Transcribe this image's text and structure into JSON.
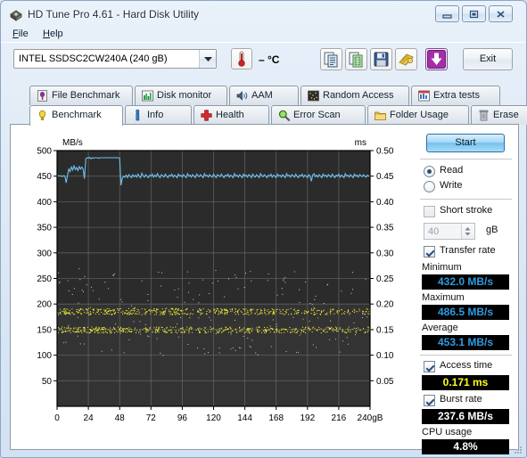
{
  "window": {
    "title": "HD Tune Pro 4.61 - Hard Disk Utility",
    "icon": "hdtune-app-icon",
    "minimize_label": "",
    "maximize_label": "",
    "close_label": ""
  },
  "menu": {
    "items": [
      {
        "label": "File",
        "mnemonic": "F"
      },
      {
        "label": "Help",
        "mnemonic": "H"
      }
    ]
  },
  "toolbar": {
    "drive": {
      "selected": "INTEL SSDSC2CW240A (240 gB)",
      "options": [
        "INTEL SSDSC2CW240A (240 gB)"
      ]
    },
    "temperature": {
      "icon": "thermometer-icon",
      "value": "– °C"
    },
    "buttons": [
      {
        "name": "copy-to-clipboard",
        "icon": "copy-icon"
      },
      {
        "name": "copy-to-spreadsheet",
        "icon": "excel-copy-icon"
      },
      {
        "name": "save-screenshot",
        "icon": "floppy-save-icon"
      },
      {
        "name": "certificate",
        "icon": "gold-folder-icon"
      },
      {
        "name": "download-update",
        "icon": "purple-down-arrow-icon"
      }
    ],
    "exit_label": "Exit"
  },
  "tabs": {
    "top_row": [
      {
        "label": "File Benchmark",
        "icon": "file-benchmark-icon",
        "active": false
      },
      {
        "label": "Disk monitor",
        "icon": "disk-monitor-icon",
        "active": false
      },
      {
        "label": "AAM",
        "icon": "speaker-icon",
        "active": false
      },
      {
        "label": "Random Access",
        "icon": "random-access-icon",
        "active": false
      },
      {
        "label": "Extra tests",
        "icon": "extra-tests-icon",
        "active": false
      }
    ],
    "bottom_row": [
      {
        "label": "Benchmark",
        "icon": "lightbulb-icon",
        "active": true
      },
      {
        "label": "Info",
        "icon": "info-icon",
        "active": false
      },
      {
        "label": "Health",
        "icon": "red-cross-icon",
        "active": false
      },
      {
        "label": "Error Scan",
        "icon": "magnifier-icon",
        "active": false
      },
      {
        "label": "Folder Usage",
        "icon": "folder-icon",
        "active": false
      },
      {
        "label": "Erase",
        "icon": "trash-icon",
        "active": false
      }
    ]
  },
  "panel": {
    "start_label": "Start",
    "mode": {
      "read_label": "Read",
      "write_label": "Write",
      "selected": "Read"
    },
    "short_stroke": {
      "label": "Short stroke",
      "checked": false,
      "size_value": "40",
      "size_unit": "gB"
    },
    "transfer_rate": {
      "label": "Transfer rate",
      "checked": true
    },
    "stats": [
      {
        "label": "Minimum",
        "value": "432.0 MB/s",
        "color": "blue"
      },
      {
        "label": "Maximum",
        "value": "486.5 MB/s",
        "color": "blue"
      },
      {
        "label": "Average",
        "value": "453.1 MB/s",
        "color": "blue"
      }
    ],
    "access_time": {
      "label": "Access time",
      "checked": true,
      "value": "0.171 ms",
      "color": "yellow"
    },
    "burst_rate": {
      "label": "Burst rate",
      "checked": true,
      "value": "237.6 MB/s",
      "color": "white"
    },
    "cpu_usage": {
      "label": "CPU usage",
      "value": "4.8%",
      "color": "white"
    }
  },
  "chart_data": {
    "type": "line",
    "title": "",
    "background": "#2b2b2b",
    "grid": true,
    "grid_color": "#6e6e6e",
    "xlabel": "",
    "x_unit": "gB",
    "xlim": [
      0,
      240
    ],
    "x_ticks": [
      0,
      24,
      48,
      72,
      96,
      120,
      144,
      168,
      192,
      216,
      240
    ],
    "x_tick_labels": [
      "0",
      "24",
      "48",
      "72",
      "96",
      "120",
      "144",
      "168",
      "192",
      "216",
      "240gB"
    ],
    "left_axis": {
      "label": "MB/s",
      "color": "#5aa9dd",
      "ylim": [
        0,
        500
      ],
      "ticks": [
        50,
        100,
        150,
        200,
        250,
        300,
        350,
        400,
        450,
        500
      ],
      "tick_labels": [
        "50",
        "100",
        "150",
        "200",
        "250",
        "300",
        "350",
        "400",
        "450",
        "500"
      ]
    },
    "right_axis": {
      "label": "ms",
      "color": "#ffff33",
      "ylim": [
        0,
        0.5
      ],
      "ticks": [
        0.05,
        0.1,
        0.15,
        0.2,
        0.25,
        0.3,
        0.35,
        0.4,
        0.45,
        0.5
      ],
      "tick_labels": [
        "0.05",
        "0.10",
        "0.15",
        "0.20",
        "0.25",
        "0.30",
        "0.35",
        "0.40",
        "0.45",
        "0.50"
      ]
    },
    "series": [
      {
        "name": "Transfer rate",
        "type": "line",
        "axis": "left",
        "color": "#6ec0ec",
        "unit": "MB/s",
        "points": [
          [
            0,
            450
          ],
          [
            1,
            451
          ],
          [
            2,
            450
          ],
          [
            3,
            451
          ],
          [
            4,
            449
          ],
          [
            5,
            451
          ],
          [
            6,
            450
          ],
          [
            7,
            437
          ],
          [
            8,
            452
          ],
          [
            9,
            464
          ],
          [
            10,
            459
          ],
          [
            11,
            468
          ],
          [
            12,
            462
          ],
          [
            13,
            470
          ],
          [
            14,
            463
          ],
          [
            15,
            467
          ],
          [
            16,
            461
          ],
          [
            17,
            469
          ],
          [
            18,
            464
          ],
          [
            19,
            468
          ],
          [
            20,
            463
          ],
          [
            21,
            445
          ],
          [
            22,
            484
          ],
          [
            23,
            486
          ],
          [
            24,
            485
          ],
          [
            25,
            487
          ],
          [
            26,
            484
          ],
          [
            27,
            486
          ],
          [
            28,
            485
          ],
          [
            29,
            486
          ],
          [
            30,
            486
          ],
          [
            31,
            486
          ],
          [
            32,
            485
          ],
          [
            33,
            486
          ],
          [
            34,
            486
          ],
          [
            35,
            486
          ],
          [
            36,
            486
          ],
          [
            37,
            486
          ],
          [
            38,
            486
          ],
          [
            39,
            486
          ],
          [
            40,
            486
          ],
          [
            41,
            486
          ],
          [
            42,
            486
          ],
          [
            43,
            486
          ],
          [
            44,
            486
          ],
          [
            45,
            486
          ],
          [
            46,
            486
          ],
          [
            47,
            486
          ],
          [
            48,
            485
          ],
          [
            49,
            432
          ],
          [
            50,
            446
          ],
          [
            51,
            450
          ],
          [
            52,
            448
          ],
          [
            53,
            452
          ],
          [
            54,
            447
          ],
          [
            55,
            453
          ],
          [
            56,
            450
          ],
          [
            57,
            447
          ],
          [
            58,
            453
          ],
          [
            59,
            449
          ],
          [
            60,
            452
          ],
          [
            61,
            448
          ],
          [
            62,
            454
          ],
          [
            63,
            450
          ],
          [
            64,
            447
          ],
          [
            65,
            456
          ],
          [
            66,
            451
          ],
          [
            67,
            448
          ],
          [
            68,
            453
          ],
          [
            69,
            450
          ],
          [
            70,
            447
          ],
          [
            71,
            452
          ],
          [
            72,
            450
          ],
          [
            73,
            454
          ],
          [
            74,
            448
          ],
          [
            75,
            452
          ],
          [
            76,
            449
          ],
          [
            77,
            455
          ],
          [
            78,
            450
          ],
          [
            79,
            447
          ],
          [
            80,
            453
          ],
          [
            81,
            451
          ],
          [
            82,
            448
          ],
          [
            83,
            454
          ],
          [
            84,
            450
          ],
          [
            85,
            447
          ],
          [
            86,
            452
          ],
          [
            87,
            450
          ],
          [
            88,
            454
          ],
          [
            89,
            448
          ],
          [
            90,
            452
          ],
          [
            91,
            450
          ],
          [
            92,
            447
          ],
          [
            93,
            454
          ],
          [
            94,
            450
          ],
          [
            95,
            452
          ],
          [
            96,
            448
          ],
          [
            97,
            453
          ],
          [
            98,
            450
          ],
          [
            99,
            447
          ],
          [
            100,
            455
          ],
          [
            101,
            450
          ],
          [
            102,
            452
          ],
          [
            103,
            448
          ],
          [
            104,
            453
          ],
          [
            105,
            450
          ],
          [
            106,
            447
          ],
          [
            107,
            454
          ],
          [
            108,
            451
          ],
          [
            109,
            449
          ],
          [
            110,
            453
          ],
          [
            111,
            450
          ],
          [
            112,
            447
          ],
          [
            113,
            455
          ],
          [
            114,
            450
          ],
          [
            115,
            452
          ],
          [
            116,
            448
          ],
          [
            117,
            453
          ],
          [
            118,
            450
          ],
          [
            119,
            448
          ],
          [
            120,
            454
          ],
          [
            121,
            450
          ],
          [
            122,
            447
          ],
          [
            123,
            453
          ],
          [
            124,
            451
          ],
          [
            125,
            449
          ],
          [
            126,
            454
          ],
          [
            127,
            450
          ],
          [
            128,
            447
          ],
          [
            129,
            452
          ],
          [
            130,
            450
          ],
          [
            131,
            454
          ],
          [
            132,
            448
          ],
          [
            133,
            452
          ],
          [
            134,
            450
          ],
          [
            135,
            447
          ],
          [
            136,
            455
          ],
          [
            137,
            450
          ],
          [
            138,
            452
          ],
          [
            139,
            448
          ],
          [
            140,
            453
          ],
          [
            141,
            450
          ],
          [
            142,
            447
          ],
          [
            143,
            454
          ],
          [
            144,
            450
          ],
          [
            145,
            452
          ],
          [
            146,
            448
          ],
          [
            147,
            453
          ],
          [
            148,
            451
          ],
          [
            149,
            447
          ],
          [
            150,
            454
          ],
          [
            151,
            450
          ],
          [
            152,
            448
          ],
          [
            153,
            453
          ],
          [
            154,
            450
          ],
          [
            155,
            447
          ],
          [
            156,
            455
          ],
          [
            157,
            451
          ],
          [
            158,
            449
          ],
          [
            159,
            453
          ],
          [
            160,
            450
          ],
          [
            161,
            447
          ],
          [
            162,
            452
          ],
          [
            163,
            450
          ],
          [
            164,
            454
          ],
          [
            165,
            448
          ],
          [
            166,
            452
          ],
          [
            167,
            450
          ],
          [
            168,
            447
          ],
          [
            169,
            454
          ],
          [
            170,
            450
          ],
          [
            171,
            452
          ],
          [
            172,
            448
          ],
          [
            173,
            453
          ],
          [
            174,
            450
          ],
          [
            175,
            447
          ],
          [
            176,
            455
          ],
          [
            177,
            450
          ],
          [
            178,
            452
          ],
          [
            179,
            448
          ],
          [
            180,
            453
          ],
          [
            181,
            451
          ],
          [
            182,
            448
          ],
          [
            183,
            454
          ],
          [
            184,
            450
          ],
          [
            185,
            447
          ],
          [
            186,
            452
          ],
          [
            187,
            450
          ],
          [
            188,
            454
          ],
          [
            189,
            448
          ],
          [
            190,
            452
          ],
          [
            191,
            450
          ],
          [
            192,
            447
          ],
          [
            193,
            453
          ],
          [
            194,
            450
          ],
          [
            195,
            440
          ],
          [
            196,
            452
          ],
          [
            197,
            455
          ],
          [
            198,
            449
          ],
          [
            199,
            452
          ],
          [
            200,
            448
          ],
          [
            201,
            453
          ],
          [
            202,
            450
          ],
          [
            203,
            447
          ],
          [
            204,
            454
          ],
          [
            205,
            450
          ],
          [
            206,
            452
          ],
          [
            207,
            448
          ],
          [
            208,
            453
          ],
          [
            209,
            451
          ],
          [
            210,
            448
          ],
          [
            211,
            454
          ],
          [
            212,
            450
          ],
          [
            213,
            447
          ],
          [
            214,
            452
          ],
          [
            215,
            450
          ],
          [
            216,
            454
          ],
          [
            217,
            448
          ],
          [
            218,
            452
          ],
          [
            219,
            450
          ],
          [
            220,
            447
          ],
          [
            221,
            455
          ],
          [
            222,
            450
          ],
          [
            223,
            452
          ],
          [
            224,
            448
          ],
          [
            225,
            453
          ],
          [
            226,
            450
          ],
          [
            227,
            447
          ],
          [
            228,
            454
          ],
          [
            229,
            450
          ],
          [
            230,
            452
          ],
          [
            231,
            448
          ],
          [
            232,
            453
          ],
          [
            233,
            451
          ],
          [
            234,
            449
          ],
          [
            235,
            453
          ],
          [
            236,
            450
          ],
          [
            237,
            448
          ],
          [
            238,
            452
          ],
          [
            239,
            450
          ],
          [
            240,
            451
          ]
        ]
      },
      {
        "name": "Access time",
        "type": "scatter",
        "axis": "right",
        "color": "#ffff33",
        "unit": "ms",
        "cluster_bands": [
          {
            "center_ms": 0.15,
            "spread_ms": 0.006,
            "density": "high"
          },
          {
            "center_ms": 0.186,
            "spread_ms": 0.006,
            "density": "high"
          }
        ],
        "outlier_range_ms": [
          0.1,
          0.27
        ],
        "average_ms": 0.171
      }
    ]
  }
}
